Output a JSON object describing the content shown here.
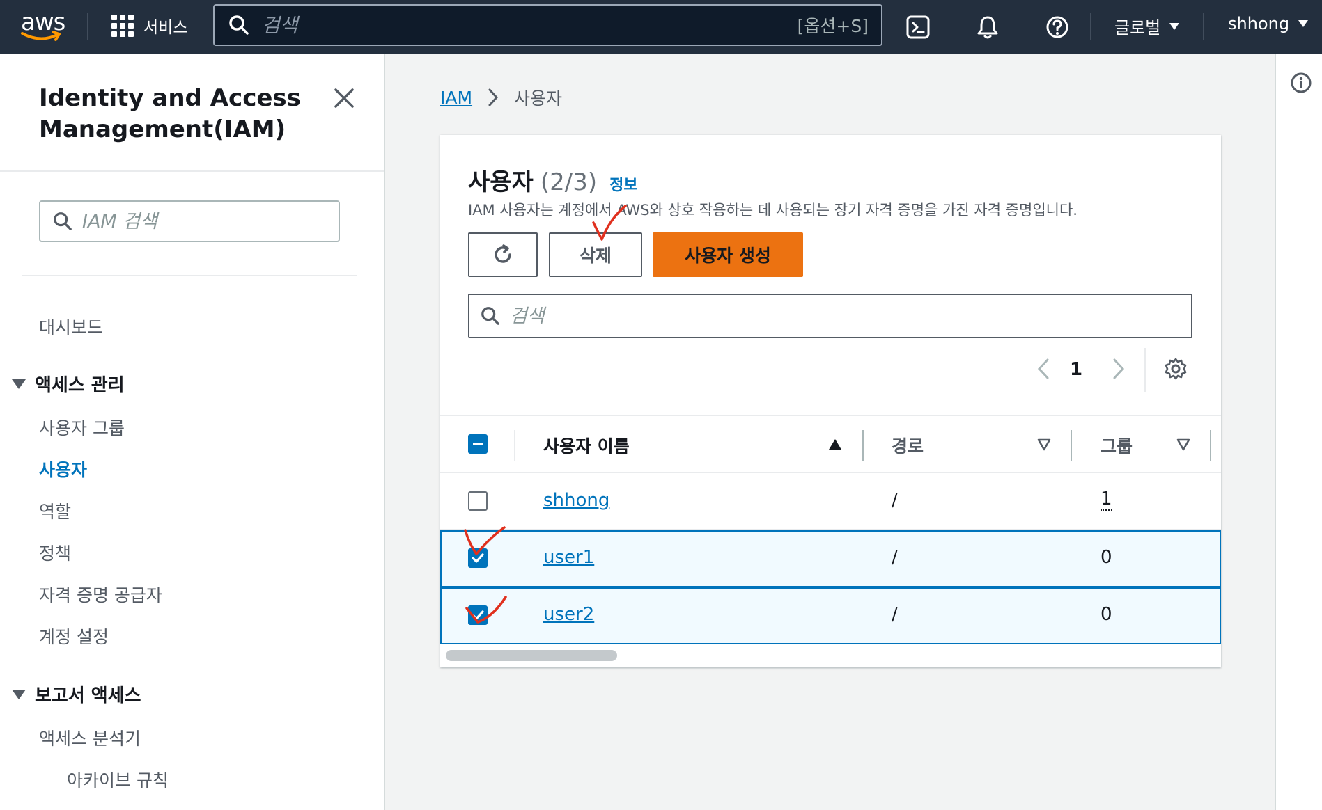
{
  "topnav": {
    "logo_text": "aws",
    "services_label": "서비스",
    "search_placeholder": "검색",
    "search_shortcut": "[옵션+S]",
    "region_label": "글로벌",
    "account_label": "shhong"
  },
  "sidenav": {
    "title": "Identity and Access Management(IAM)",
    "search_placeholder": "IAM 검색",
    "dashboard": "대시보드",
    "access_management": {
      "label": "액세스 관리",
      "items": [
        "사용자 그룹",
        "사용자",
        "역할",
        "정책",
        "자격 증명 공급자",
        "계정 설정"
      ],
      "active": "사용자"
    },
    "access_reports": {
      "label": "보고서 액세스",
      "items": [
        "액세스 분석기"
      ],
      "subitems": [
        "아카이브 규칙"
      ]
    }
  },
  "breadcrumb": {
    "root": "IAM",
    "current": "사용자"
  },
  "panel": {
    "title": "사용자",
    "count": "(2/3)",
    "info_link": "정보",
    "description": "IAM 사용자는 계정에서 AWS와 상호 작용하는 데 사용되는 장기 자격 증명을 가진 자격 증명입니다.",
    "delete_label": "삭제",
    "create_label": "사용자 생성",
    "search_placeholder": "검색",
    "page_number": "1"
  },
  "table": {
    "columns": [
      "사용자 이름",
      "경로",
      "그룹"
    ],
    "rows": [
      {
        "name": "shhong",
        "path": "/",
        "groups": "1",
        "checked": false
      },
      {
        "name": "user1",
        "path": "/",
        "groups": "0",
        "checked": true
      },
      {
        "name": "user2",
        "path": "/",
        "groups": "0",
        "checked": true
      }
    ]
  },
  "colors": {
    "nav_bg": "#232f3e",
    "link": "#0073bb",
    "primary_button": "#ec7211",
    "annotation": "#e0301e"
  }
}
